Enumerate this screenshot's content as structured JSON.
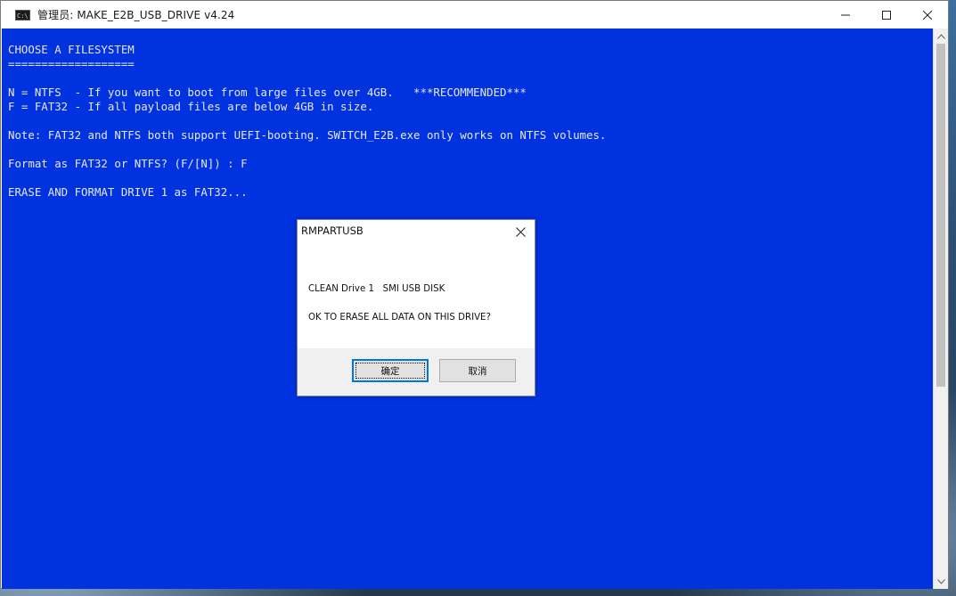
{
  "window": {
    "title": "管理员:  MAKE_E2B_USB_DRIVE v4.24",
    "icon": "C:\\",
    "controls": [
      "minimize-icon",
      "maximize-icon",
      "close-icon"
    ]
  },
  "console": {
    "background": "#0032e0",
    "lines": [
      "CHOOSE A FILESYSTEM",
      "===================",
      "",
      "N = NTFS  - If you want to boot from large files over 4GB.   ***RECOMMENDED***",
      "F = FAT32 - If all payload files are below 4GB in size.",
      "",
      "Note: FAT32 and NTFS both support UEFI-booting. SWITCH_E2B.exe only works on NTFS volumes.",
      "",
      "Format as FAT32 or NTFS? (F/[N]) : F",
      "",
      "ERASE AND FORMAT DRIVE 1 as FAT32..."
    ]
  },
  "dialog": {
    "title": "RMPARTUSB",
    "message_line1": "CLEAN Drive 1   SMI USB DISK",
    "message_line2": "OK TO ERASE ALL DATA ON THIS DRIVE?",
    "ok_label": "确定",
    "cancel_label": "取消"
  }
}
